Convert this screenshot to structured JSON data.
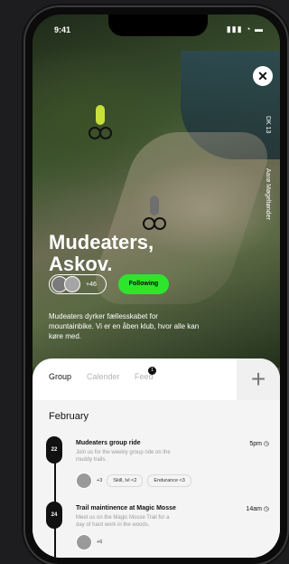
{
  "status_bar": {
    "time": "9:41",
    "icons": "▮▮▮ ◔ ▬"
  },
  "hero": {
    "side_text_1": "DK 13",
    "side_text_2": "Aarø Møgeltønder",
    "title_line1": "Mudeaters,",
    "title_line2": "Askov.",
    "members_count": "+46",
    "follow_label": "Following",
    "description": "Mudeaters dyrker fællesskabet for mountainbike. Vi er en åben klub, hvor alle kan køre med."
  },
  "tabs": [
    {
      "label": "Group"
    },
    {
      "label": "Calender"
    },
    {
      "label": "Feed"
    }
  ],
  "feed_badge": "1",
  "add_icon": "plus-icon",
  "month": "February",
  "events": [
    {
      "date": "22",
      "title": "Mudeaters group ride",
      "subtitle": "Join us for the weekly group ride on the muddy trails.",
      "time": "5pm",
      "attendees_more": "+3",
      "chips": [
        "Skill, lvl <2",
        "Endurance <3"
      ]
    },
    {
      "date": "24",
      "title": "Trail maintinence at Magic Mosse",
      "subtitle": "Meet us on the Magic Mosse Trail for a day of hard work in the woods.",
      "time": "14am",
      "attendees_more": "+6",
      "chips": []
    }
  ],
  "colors": {
    "accent": "#2ee52e",
    "dark": "#111111"
  }
}
